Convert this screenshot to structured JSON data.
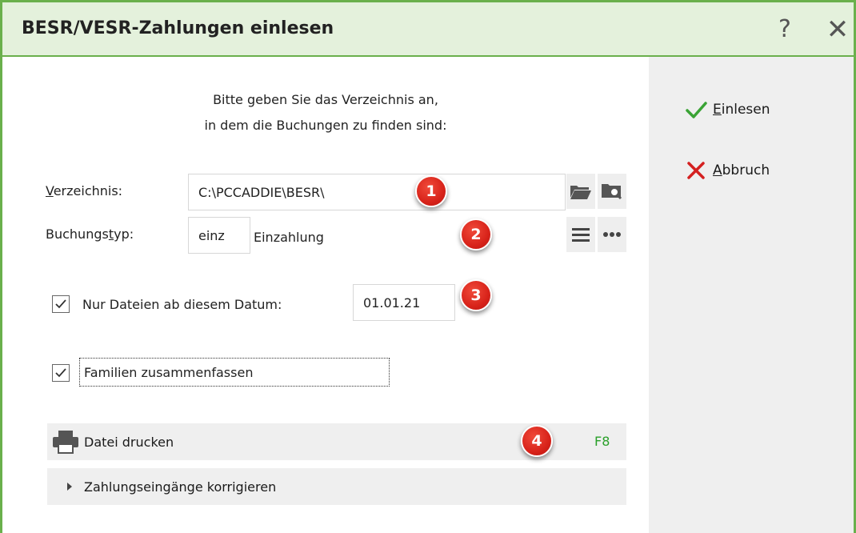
{
  "window": {
    "title": "BESR/VESR-Zahlungen einlesen",
    "help_label": "?",
    "close_label": "✕",
    "accent_color": "#6ab04c"
  },
  "actions": {
    "read": {
      "mnemonic": "E",
      "rest": "inlesen",
      "icon": "checkmark-icon",
      "color": "#3aa335"
    },
    "cancel": {
      "mnemonic": "A",
      "rest": "bbruch",
      "icon": "cross-icon",
      "color": "#d42020"
    }
  },
  "intro": {
    "line1": "Bitte geben Sie das Verzeichnis an,",
    "line2": "in dem die Buchungen zu finden sind:"
  },
  "directory": {
    "label_mnemonic": "V",
    "label_rest": "erzeichnis:",
    "value": "C:\\PCCADDIE\\BESR\\"
  },
  "booking_type": {
    "label_pre": "Buchungs",
    "label_mnemonic": "t",
    "label_post": "yp:",
    "code": "einz",
    "description": "Einzahlung"
  },
  "date_filter": {
    "checked": true,
    "label": "Nur Dateien ab diesem Datum:",
    "value": "01.01.21"
  },
  "families": {
    "checked": true,
    "label": "Familien zusammenfassen"
  },
  "print_row": {
    "label": "Datei drucken",
    "shortcut": "F8",
    "icon": "printer-icon"
  },
  "correct_row": {
    "label": "Zahlungseingänge korrigieren",
    "icon": "triangle-right-icon"
  },
  "badges": [
    "1",
    "2",
    "3",
    "4"
  ]
}
